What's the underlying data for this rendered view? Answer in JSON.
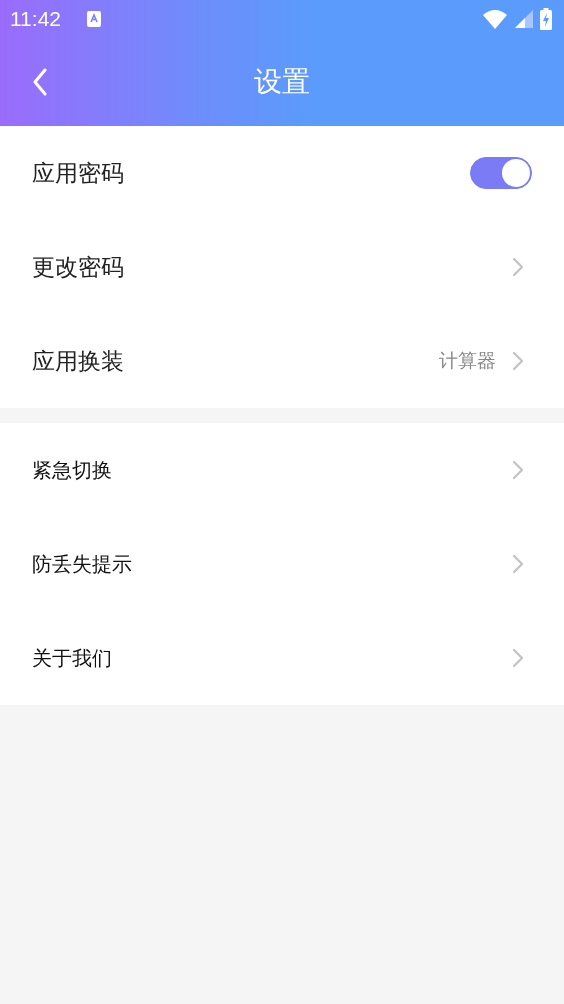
{
  "status_bar": {
    "time": "11:42"
  },
  "header": {
    "title": "设置"
  },
  "groups": [
    {
      "kind": "primary",
      "items": [
        {
          "kind": "toggle",
          "label": "应用密码",
          "on": true
        },
        {
          "kind": "link",
          "label": "更改密码"
        },
        {
          "kind": "link",
          "label": "应用换装",
          "value": "计算器"
        }
      ]
    },
    {
      "kind": "secondary",
      "items": [
        {
          "kind": "link",
          "label": "紧急切换"
        },
        {
          "kind": "link",
          "label": "防丢失提示"
        },
        {
          "kind": "link",
          "label": "关于我们"
        }
      ]
    }
  ]
}
